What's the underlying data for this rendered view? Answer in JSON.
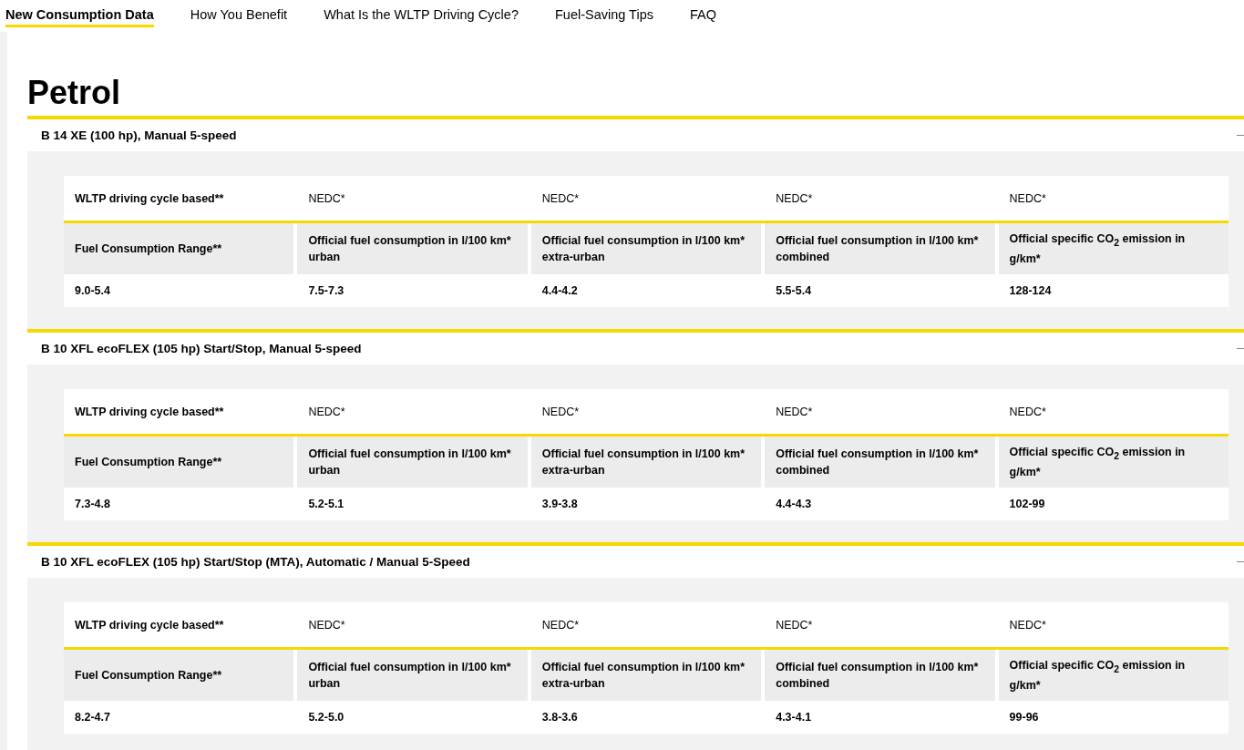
{
  "nav": [
    {
      "label": "New Consumption Data",
      "selected": true
    },
    {
      "label": "How You Benefit",
      "selected": false
    },
    {
      "label": "What Is the WLTP Driving Cycle?",
      "selected": false
    },
    {
      "label": "Fuel-Saving Tips",
      "selected": false
    },
    {
      "label": "FAQ",
      "selected": false
    }
  ],
  "heading": "Petrol",
  "sections": [
    {
      "title": "B 14 XE (100 hp), Manual 5-speed",
      "expanded": true,
      "header_row": [
        "WLTP driving cycle based**",
        "NEDC*",
        "NEDC*",
        "NEDC*",
        "NEDC*"
      ],
      "label_row": [
        "Fuel Consumption Range**",
        "Official fuel consumption in l/100 km* urban",
        "Official fuel consumption in l/100 km* extra-urban",
        "Official fuel consumption in l/100 km* combined",
        "Official specific CO$_{2}$ emission in g/km*"
      ],
      "value_row": [
        "9.0-5.4",
        "7.5-7.3",
        "4.4-4.2",
        "5.5-5.4",
        "128-124"
      ]
    },
    {
      "title": "B 10 XFL ecoFLEX (105 hp) Start/Stop, Manual 5-speed",
      "expanded": true,
      "header_row": [
        "WLTP driving cycle based**",
        "NEDC*",
        "NEDC*",
        "NEDC*",
        "NEDC*"
      ],
      "label_row": [
        "Fuel Consumption Range**",
        "Official fuel consumption in l/100 km* urban",
        "Official fuel consumption in l/100 km* extra-urban",
        "Official fuel consumption in l/100 km* combined",
        "Official specific CO$_{2}$ emission in g/km*"
      ],
      "value_row": [
        "7.3-4.8",
        "5.2-5.1",
        "3.9-3.8",
        "4.4-4.3",
        "102-99"
      ]
    },
    {
      "title": "B 10 XFL ecoFLEX (105 hp) Start/Stop (MTA), Automatic / Manual 5-Speed",
      "expanded": true,
      "header_row": [
        "WLTP driving cycle based**",
        "NEDC*",
        "NEDC*",
        "NEDC*",
        "NEDC*"
      ],
      "label_row": [
        "Fuel Consumption Range**",
        "Official fuel consumption in l/100 km* urban",
        "Official fuel consumption in l/100 km* extra-urban",
        "Official fuel consumption in l/100 km* combined",
        "Official specific CO$_{2}$ emission in g/km*"
      ],
      "value_row": [
        "8.2-4.7",
        "5.2-5.0",
        "3.8-3.6",
        "4.3-4.1",
        "99-96"
      ]
    }
  ]
}
